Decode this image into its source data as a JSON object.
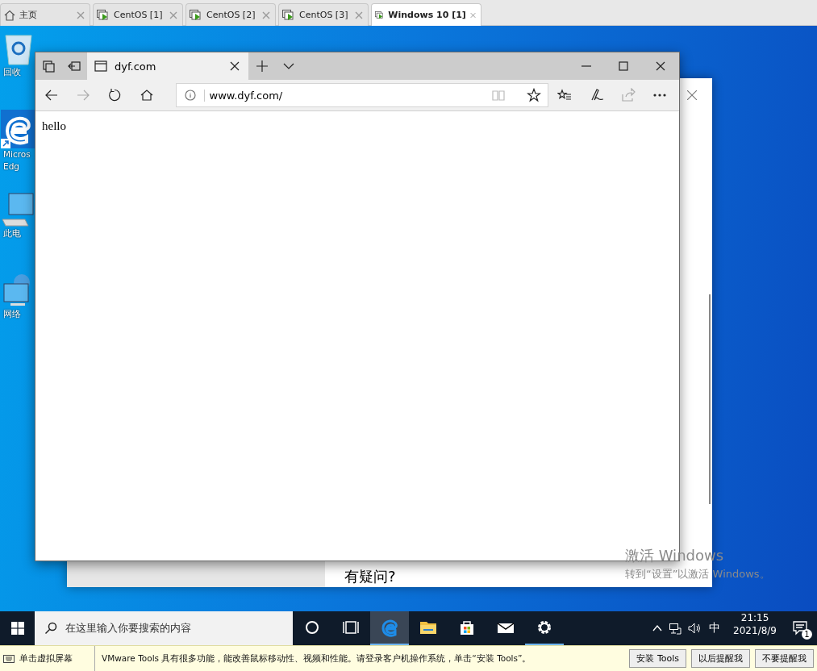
{
  "vm_tabs": [
    {
      "label": "主页",
      "kind": "home",
      "selected": false
    },
    {
      "label": "CentOS [1]",
      "kind": "vm",
      "selected": false
    },
    {
      "label": "CentOS [2]",
      "kind": "vm",
      "selected": false
    },
    {
      "label": "CentOS [3]",
      "kind": "vm",
      "selected": false
    },
    {
      "label": "Windows 10 [1]",
      "kind": "vm",
      "selected": true
    }
  ],
  "desktop_icons": [
    {
      "kind": "recycle",
      "lines": [
        "回收"
      ]
    },
    {
      "kind": "edge",
      "lines": [
        "Micros",
        "Edg"
      ]
    },
    {
      "kind": "computer",
      "lines": [
        "此电"
      ]
    },
    {
      "kind": "network",
      "lines": [
        "网络"
      ]
    }
  ],
  "settings_window": {
    "heading": "有疑问?"
  },
  "browser": {
    "tab_title": "dyf.com",
    "address": "www.dyf.com/",
    "page_text": "hello"
  },
  "activation": {
    "title": "激活 Windows",
    "subtitle": "转到“设置”以激活 Windows。"
  },
  "taskbar": {
    "search_placeholder": "在这里输入你要搜索的内容",
    "apps": [
      {
        "kind": "cortana",
        "running": false,
        "selected": false
      },
      {
        "kind": "taskview",
        "running": false,
        "selected": false
      },
      {
        "kind": "edge",
        "running": true,
        "selected": true
      },
      {
        "kind": "explorer",
        "running": false,
        "selected": false
      },
      {
        "kind": "store",
        "running": false,
        "selected": false
      },
      {
        "kind": "mail",
        "running": false,
        "selected": false
      },
      {
        "kind": "settings",
        "running": true,
        "selected": false
      }
    ],
    "ime": "中",
    "time": "21:15",
    "date": "2021/8/9",
    "notification_count": "1"
  },
  "vmware_bar": {
    "hint": "单击虚拟屏幕",
    "message": "VMware Tools 具有很多功能，能改善鼠标移动性、视频和性能。请登录客户机操作系统，单击“安装 Tools”。",
    "buttons": [
      "安装 Tools",
      "以后提醒我",
      "不要提醒我"
    ]
  }
}
